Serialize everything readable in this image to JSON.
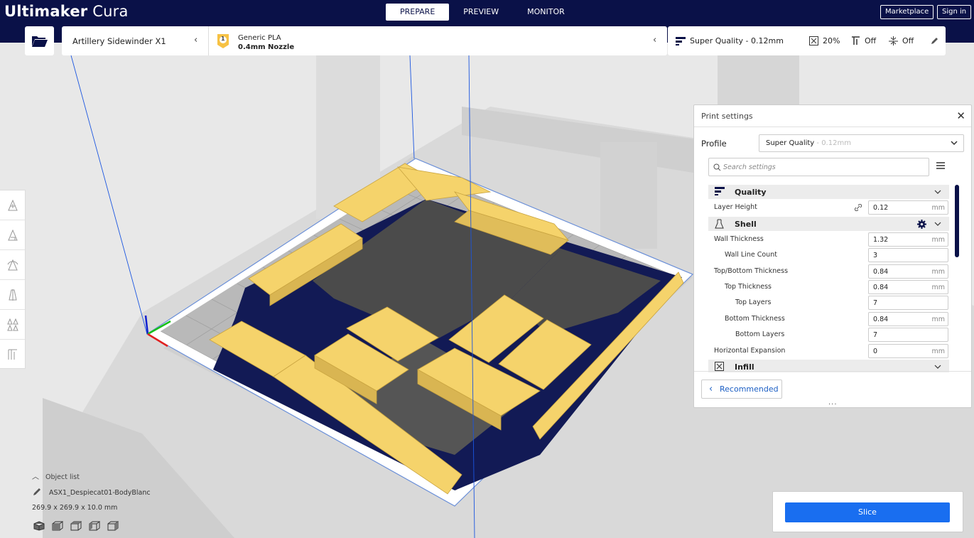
{
  "app": {
    "brand_bold": "Ultimaker",
    "brand_light": "Cura"
  },
  "stages": [
    "PREPARE",
    "PREVIEW",
    "MONITOR"
  ],
  "header_buttons": {
    "marketplace": "Marketplace",
    "sign_in": "Sign in"
  },
  "printer": {
    "name": "Artillery Sidewinder X1"
  },
  "material": {
    "badge": "1",
    "name": "Generic PLA",
    "nozzle": "0.4mm Nozzle"
  },
  "quality_bar": {
    "profile": "Super Quality - 0.12mm",
    "infill": "20%",
    "support": "Off",
    "adhesion": "Off"
  },
  "print_settings": {
    "title": "Print settings",
    "profile_label": "Profile",
    "profile_value": "Super Quality",
    "profile_value_dim": "- 0.12mm",
    "search_placeholder": "Search settings",
    "categories": {
      "quality": "Quality",
      "shell": "Shell",
      "infill": "Infill"
    },
    "rows": {
      "layer_height": {
        "label": "Layer Height",
        "value": "0.12",
        "unit": "mm"
      },
      "wall_thickness": {
        "label": "Wall Thickness",
        "value": "1.32",
        "unit": "mm"
      },
      "wall_line_count": {
        "label": "Wall Line Count",
        "value": "3"
      },
      "top_bottom_thickness": {
        "label": "Top/Bottom Thickness",
        "value": "0.84",
        "unit": "mm"
      },
      "top_thickness": {
        "label": "Top Thickness",
        "value": "0.84",
        "unit": "mm"
      },
      "top_layers": {
        "label": "Top Layers",
        "value": "7"
      },
      "bottom_thickness": {
        "label": "Bottom Thickness",
        "value": "0.84",
        "unit": "mm"
      },
      "bottom_layers": {
        "label": "Bottom Layers",
        "value": "7"
      },
      "horizontal_expansion": {
        "label": "Horizontal Expansion",
        "value": "0",
        "unit": "mm"
      }
    },
    "recommended_label": "Recommended",
    "dots": "..."
  },
  "object_info": {
    "list_label": "Object list",
    "name": "ASX1_Despiecat01-BodyBlanc",
    "dimensions": "269.9 x 269.9 x 10.0 mm"
  },
  "slice": {
    "label": "Slice"
  },
  "colors": {
    "navy": "#0a1148",
    "accent_blue": "#196ef0",
    "part_yellow": "#f5d36b",
    "badge_yellow": "#f7c244"
  }
}
